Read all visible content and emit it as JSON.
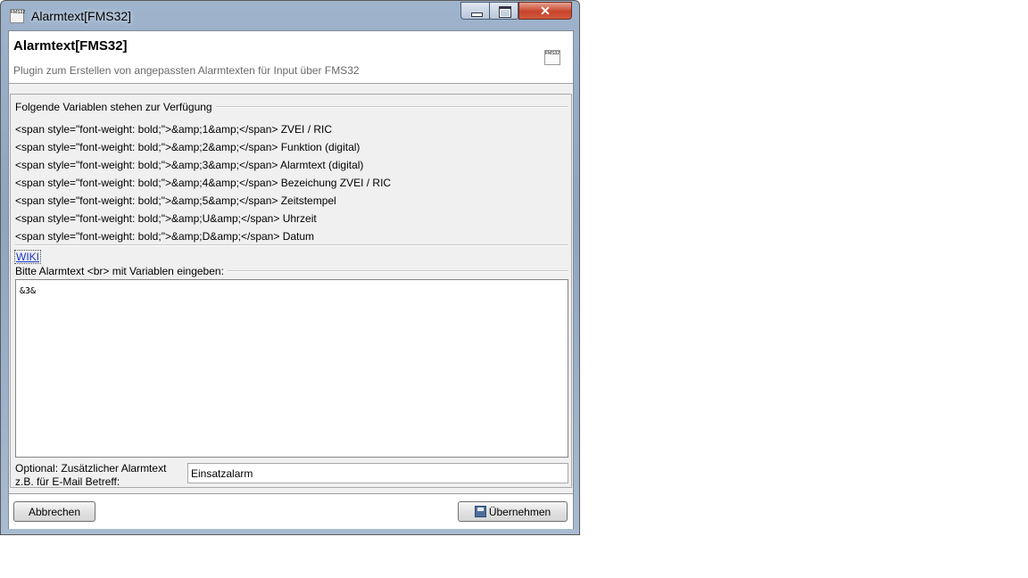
{
  "window": {
    "title": "Alarmtext[FMS32]",
    "close_glyph": "✕",
    "app_icon": "FMS32"
  },
  "header": {
    "title": "Alarmtext[FMS32]",
    "subtitle": "Plugin zum Erstellen von angepassten Alarmtexten für Input über FMS32",
    "icon": "FMS32"
  },
  "variables": {
    "heading": "Folgende Variablen stehen zur Verfügung",
    "items": [
      "<span style=\"font-weight: bold;\">&amp;1&amp;</span> ZVEI / RIC",
      "<span style=\"font-weight: bold;\">&amp;2&amp;</span> Funktion (digital)",
      "<span style=\"font-weight: bold;\">&amp;3&amp;</span> Alarmtext (digital)",
      "<span style=\"font-weight: bold;\">&amp;4&amp;</span> Bezeichung ZVEI / RIC",
      "<span style=\"font-weight: bold;\">&amp;5&amp;</span> Zeitstempel",
      "<span style=\"font-weight: bold;\">&amp;U&amp;</span> Uhrzeit",
      "<span style=\"font-weight: bold;\">&amp;D&amp;</span> Datum"
    ]
  },
  "wiki_link": "WIKI",
  "alarmtext": {
    "heading": "Bitte Alarmtext <br> mit Variablen eingeben:",
    "value": "&3&"
  },
  "optional": {
    "label_line1": "Optional: Zusätzlicher Alarmtext",
    "label_line2": "z.B. für E-Mail Betreff:",
    "value": "Einsatzalarm"
  },
  "buttons": {
    "cancel": "Abbrechen",
    "apply": "Übernehmen"
  }
}
